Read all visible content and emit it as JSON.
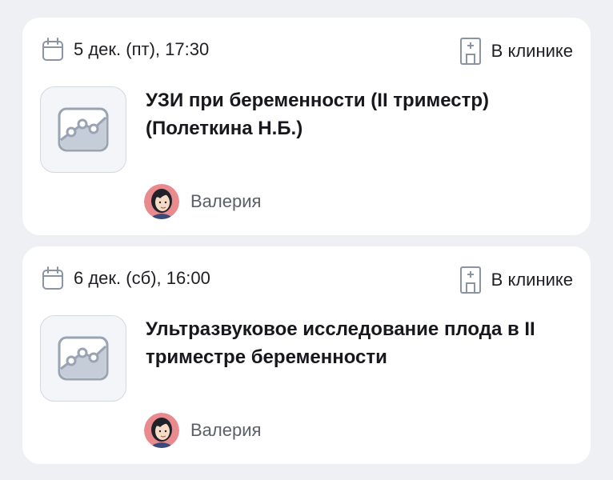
{
  "appointments": [
    {
      "date": "5 дек. (пт), 17:30",
      "place": "В клинике",
      "title_line1": "УЗИ при беременности (II триместр)",
      "title_line2": "(Полеткина Н.Б.)",
      "patient": "Валерия",
      "date_icon": "calendar-icon",
      "place_icon": "clinic-icon",
      "thumb_icon": "ultrasound-icon"
    },
    {
      "date": "6 дек. (сб), 16:00",
      "place": "В клинике",
      "title_line1": "Ультразвуковое исследование плода в II",
      "title_line2": "триместре беременности",
      "patient": "Валерия",
      "date_icon": "calendar-icon",
      "place_icon": "clinic-icon",
      "thumb_icon": "ultrasound-icon"
    }
  ],
  "colors": {
    "page_background": "#eef0f4",
    "card_background": "#ffffff",
    "icon_stroke": "#9aa3b2",
    "text_primary": "#16181d",
    "text_secondary": "#5b5f68",
    "avatar_background": "#e98a8e"
  }
}
